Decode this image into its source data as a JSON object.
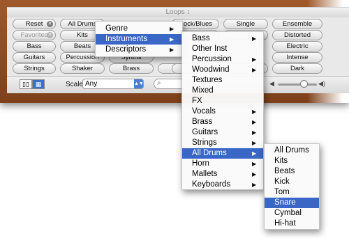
{
  "window": {
    "title": "Loops ↕"
  },
  "keywords": {
    "col1": [
      "Reset",
      "Favorites",
      "Bass",
      "Guitars",
      "Strings"
    ],
    "col2": [
      "All Drums",
      "Kits",
      "Beats",
      "Percussion",
      "Shaker"
    ],
    "col3_visible": [
      "Synths",
      "Brass"
    ],
    "col4": [
      "Rock/Blues",
      "",
      "",
      "",
      ""
    ],
    "col5": [
      "Single",
      "",
      "",
      "",
      ""
    ],
    "col6": [
      "Ensemble",
      "Distorted",
      "Electric",
      "Intense",
      "Dark"
    ]
  },
  "bottombar": {
    "scale_label": "Scale:",
    "scale_value": "Any",
    "search_glyph": "Q"
  },
  "menu1": {
    "items": [
      "Genre",
      "Instruments",
      "Descriptors"
    ],
    "highlighted": "Instruments"
  },
  "menu2": {
    "items": [
      "Bass",
      "Other Inst",
      "Percussion",
      "Woodwind",
      "Textures",
      "Mixed",
      "FX",
      "Vocals",
      "Brass",
      "Guitars",
      "Strings",
      "All Drums",
      "Horn",
      "Mallets",
      "Keyboards"
    ],
    "highlighted": "All Drums"
  },
  "menu3": {
    "items": [
      "All Drums",
      "Kits",
      "Beats",
      "Kick",
      "Tom",
      "Snare",
      "Cymbal",
      "Hi-hat"
    ],
    "highlighted": "Snare"
  },
  "colors": {
    "highlight": "#3a67c6",
    "wood": "#8b4a1e"
  }
}
